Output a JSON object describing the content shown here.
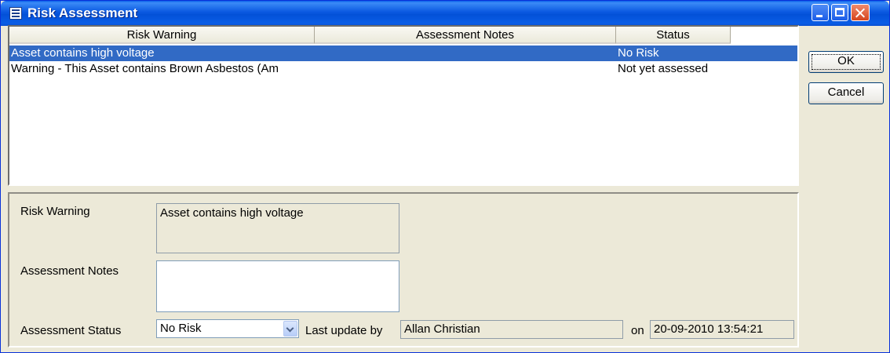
{
  "window": {
    "title": "Risk Assessment"
  },
  "list": {
    "columns": [
      "Risk Warning",
      "Assessment Notes",
      "Status"
    ],
    "rows": [
      {
        "warning": "Asset contains high voltage",
        "notes": "",
        "status": "No Risk",
        "selected": true
      },
      {
        "warning": "Warning - This Asset contains Brown Asbestos (Am",
        "notes": "",
        "status": "Not yet assessed",
        "selected": false
      }
    ]
  },
  "details": {
    "risk_warning_label": "Risk Warning",
    "risk_warning_value": "Asset contains high voltage",
    "assessment_notes_label": "Assessment Notes",
    "assessment_notes_value": "",
    "assessment_status_label": "Assessment Status",
    "assessment_status_value": "No Risk",
    "last_update_label": "Last update by",
    "last_update_value": "Allan Christian",
    "on_label": "on",
    "on_value": "20-09-2010 13:54:21"
  },
  "buttons": {
    "ok": "OK",
    "cancel": "Cancel"
  }
}
